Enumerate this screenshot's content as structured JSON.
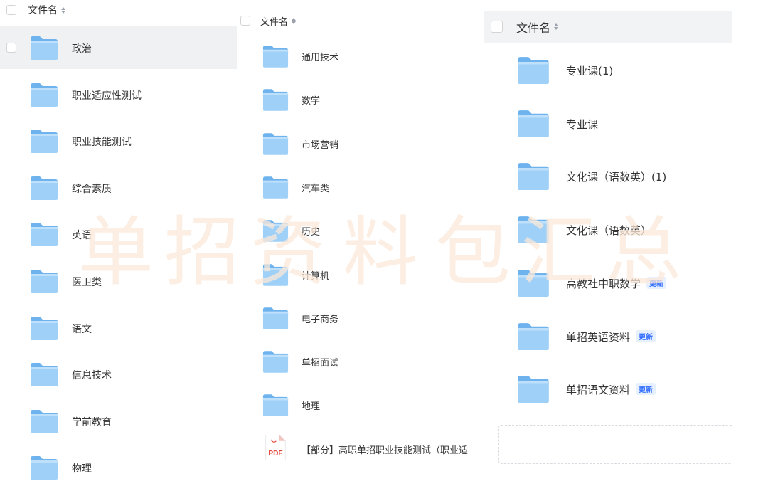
{
  "header_label": "文件名",
  "panels": [
    {
      "items": [
        {
          "label": "政治",
          "type": "folder",
          "highlighted": true
        },
        {
          "label": "职业适应性测试",
          "type": "folder"
        },
        {
          "label": "职业技能测试",
          "type": "folder"
        },
        {
          "label": "综合素质",
          "type": "folder"
        },
        {
          "label": "英语",
          "type": "folder"
        },
        {
          "label": "医卫类",
          "type": "folder"
        },
        {
          "label": "语文",
          "type": "folder"
        },
        {
          "label": "信息技术",
          "type": "folder"
        },
        {
          "label": "学前教育",
          "type": "folder"
        },
        {
          "label": "物理",
          "type": "folder"
        }
      ]
    },
    {
      "items": [
        {
          "label": "通用技术",
          "type": "folder"
        },
        {
          "label": "数学",
          "type": "folder"
        },
        {
          "label": "市场营销",
          "type": "folder"
        },
        {
          "label": "汽车类",
          "type": "folder"
        },
        {
          "label": "历史",
          "type": "folder"
        },
        {
          "label": "计算机",
          "type": "folder"
        },
        {
          "label": "电子商务",
          "type": "folder"
        },
        {
          "label": "单招面试",
          "type": "folder"
        },
        {
          "label": "地理",
          "type": "folder"
        },
        {
          "label": "【部分】高职单招职业技能测试（职业适",
          "type": "pdf"
        }
      ]
    },
    {
      "items": [
        {
          "label": "专业课(1)",
          "type": "folder"
        },
        {
          "label": "专业课",
          "type": "folder"
        },
        {
          "label": "文化课（语数英）(1)",
          "type": "folder"
        },
        {
          "label": "文化课（语数英）",
          "type": "folder"
        },
        {
          "label": "高教社中职数学",
          "type": "folder",
          "badge": "更新"
        },
        {
          "label": "单招英语资料",
          "type": "folder",
          "badge": "更新"
        },
        {
          "label": "单招语文资料",
          "type": "folder",
          "badge": "更新"
        }
      ]
    }
  ],
  "pdf_icon_text": "PDF",
  "watermark": "单招资料包汇总",
  "colors": {
    "folder_front": "#9fd0f8",
    "folder_back": "#6fb3ee",
    "badge_bg": "#e7f0ff",
    "badge_text": "#2f6bff",
    "pdf_red": "#e5473b",
    "watermark": "#fbe9d9"
  }
}
